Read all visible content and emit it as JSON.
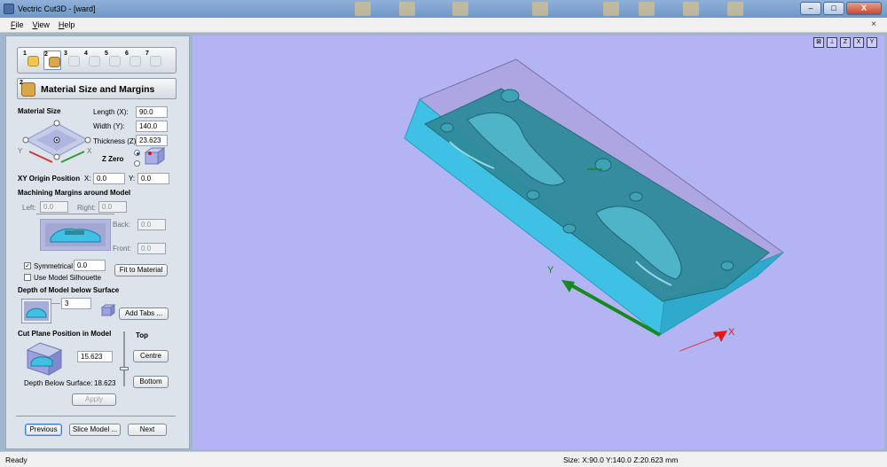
{
  "window": {
    "title": "Vectric Cut3D - [ward]",
    "buttons": {
      "minimize": "–",
      "maximize": "□",
      "close": "X"
    }
  },
  "menu": [
    "File",
    "View",
    "Help"
  ],
  "panel": {
    "steps": [
      {
        "num": "1",
        "icon": "open-folder-icon"
      },
      {
        "num": "2",
        "icon": "material-size-icon"
      },
      {
        "num": "3",
        "icon": "orientation-icon"
      },
      {
        "num": "4",
        "icon": "roughing-icon"
      },
      {
        "num": "5",
        "icon": "finishing-icon"
      },
      {
        "num": "6",
        "icon": "preview-icon"
      },
      {
        "num": "7",
        "icon": "save-toolpath-icon"
      }
    ],
    "section_num": "2",
    "section_title": "Material Size and Margins",
    "material_size": {
      "heading": "Material Size",
      "length_label": "Length (X):",
      "length": "90.0",
      "width_label": "Width (Y):",
      "width": "140.0",
      "thickness_label": "Thickness (Z):",
      "thickness": "23.623",
      "z_zero_label": "Z Zero",
      "axis_y": "Y",
      "axis_x": "X"
    },
    "xy_origin": {
      "label": "XY Origin Position",
      "x_label": "X:",
      "x": "0.0",
      "y_label": "Y:",
      "y": "0.0"
    },
    "margins": {
      "heading": "Machining Margins around Model",
      "left_label": "Left:",
      "left": "0.0",
      "right_label": "Right:",
      "right": "0.0",
      "back_label": "Back:",
      "back": "0.0",
      "front_label": "Front:",
      "front": "0.0",
      "symmetrical_label": "Symmetrical",
      "symmetrical": "0.0",
      "fit_button": "Fit to Material",
      "silhouette_label": "Use Model Silhouette"
    },
    "depth": {
      "heading": "Depth of Model below Surface",
      "value": "3",
      "add_tabs_button": "Add Tabs ..."
    },
    "cut_plane": {
      "heading": "Cut Plane Position in Model",
      "top_label": "Top",
      "value": "15.623",
      "centre_button": "Centre",
      "bottom_button": "Bottom",
      "depth_below_label": "Depth Below Surface:",
      "depth_below": "18.623",
      "apply_button": "Apply"
    },
    "nav": {
      "previous": "Previous",
      "slice": "Slice Model ...",
      "next": "Next"
    }
  },
  "viewport": {
    "axis_x": "X",
    "axis_y": "Y",
    "tools": [
      {
        "icon": "zoom-extents-icon",
        "glyph": "⊠"
      },
      {
        "icon": "iso-view-icon",
        "glyph": "⊥"
      },
      {
        "icon": "view-z-icon",
        "glyph": "Z"
      },
      {
        "icon": "view-x-icon",
        "glyph": "X"
      },
      {
        "icon": "view-y-icon",
        "glyph": "Y"
      }
    ],
    "colors": {
      "background": "#b4b4f4",
      "model": "#2e8a9a",
      "block": "#3fc1e6",
      "x_axis": "#e01818",
      "y_axis": "#168a1e"
    }
  },
  "status": {
    "left": "Ready",
    "right": "Size: X:90.0 Y:140.0 Z:20.623 mm"
  }
}
